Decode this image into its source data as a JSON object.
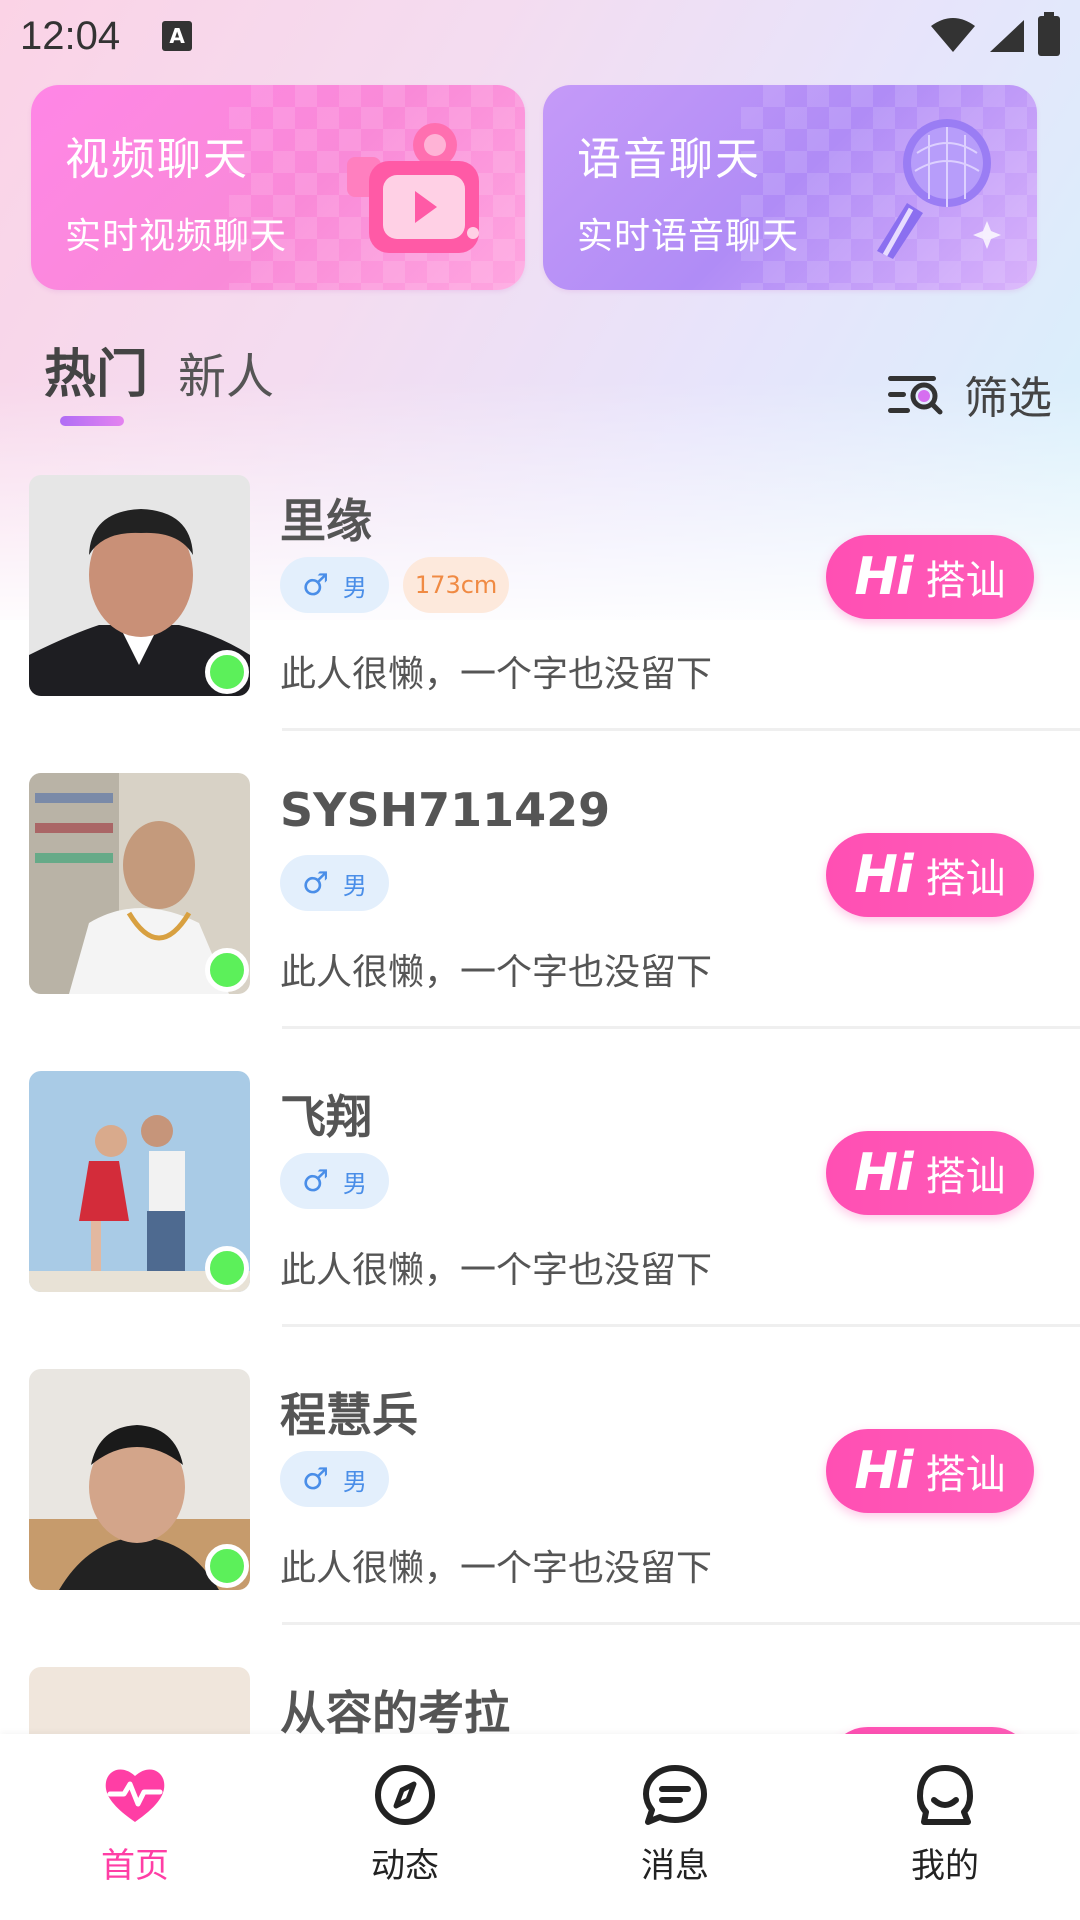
{
  "status_bar": {
    "time": "12:04",
    "keyboard_indicator": "A"
  },
  "cards": [
    {
      "title": "视频聊天",
      "subtitle": "实时视频聊天",
      "icon": "video-camera-icon",
      "color": "#f98ad8"
    },
    {
      "title": "语音聊天",
      "subtitle": "实时语音聊天",
      "icon": "microphone-icon",
      "color": "#b08cf6"
    }
  ],
  "tabs": [
    {
      "label": "热门",
      "active": true
    },
    {
      "label": "新人",
      "active": false
    }
  ],
  "filter": {
    "label": "筛选",
    "icon": "filter-search-icon"
  },
  "users": [
    {
      "name": "里缘",
      "gender_symbol": "♂",
      "gender": "男",
      "height": "173cm",
      "signature": "此人很懒，一个字也没留下",
      "online": true
    },
    {
      "name": "SYSH711429",
      "gender_symbol": "♂",
      "gender": "男",
      "height": "",
      "signature": "此人很懒，一个字也没留下",
      "online": true
    },
    {
      "name": "飞翔",
      "gender_symbol": "♂",
      "gender": "男",
      "height": "",
      "signature": "此人很懒，一个字也没留下",
      "online": true
    },
    {
      "name": "程慧兵",
      "gender_symbol": "♂",
      "gender": "男",
      "height": "",
      "signature": "此人很懒，一个字也没留下",
      "online": true
    },
    {
      "name": "从容的考拉",
      "gender_symbol": "",
      "gender": "",
      "height": "",
      "signature": "",
      "online": false
    }
  ],
  "hi_button": {
    "hi": "Hi",
    "label": "搭讪"
  },
  "bottom_nav": [
    {
      "label": "首页",
      "icon": "heartbeat-icon",
      "active": true
    },
    {
      "label": "动态",
      "icon": "compass-icon",
      "active": false
    },
    {
      "label": "消息",
      "icon": "chat-bubble-icon",
      "active": false
    },
    {
      "label": "我的",
      "icon": "profile-icon",
      "active": false
    }
  ],
  "colors": {
    "accent_pink": "#ff4fb3",
    "online_green": "#5cf05a",
    "gender_blue": "#4a8ee8",
    "height_orange": "#f08a43"
  }
}
